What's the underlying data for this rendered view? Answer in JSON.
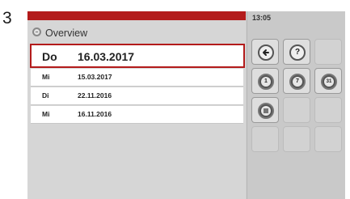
{
  "step_number": "3",
  "header": {
    "title": "Overview",
    "time": "13:05"
  },
  "list": [
    {
      "day": "Do",
      "date": "16.03.2017",
      "selected": true
    },
    {
      "day": "Mi",
      "date": "15.03.2017",
      "selected": false
    },
    {
      "day": "Di",
      "date": "22.11.2016",
      "selected": false
    },
    {
      "day": "Mi",
      "date": "16.11.2016",
      "selected": false
    }
  ],
  "buttons": {
    "help_label": "?",
    "day_label": "1",
    "week_label": "7",
    "month_label": "31"
  },
  "colors": {
    "accent": "#b31b1b",
    "panel": "#d6d6d6",
    "sidebar": "#c9c9c9"
  }
}
